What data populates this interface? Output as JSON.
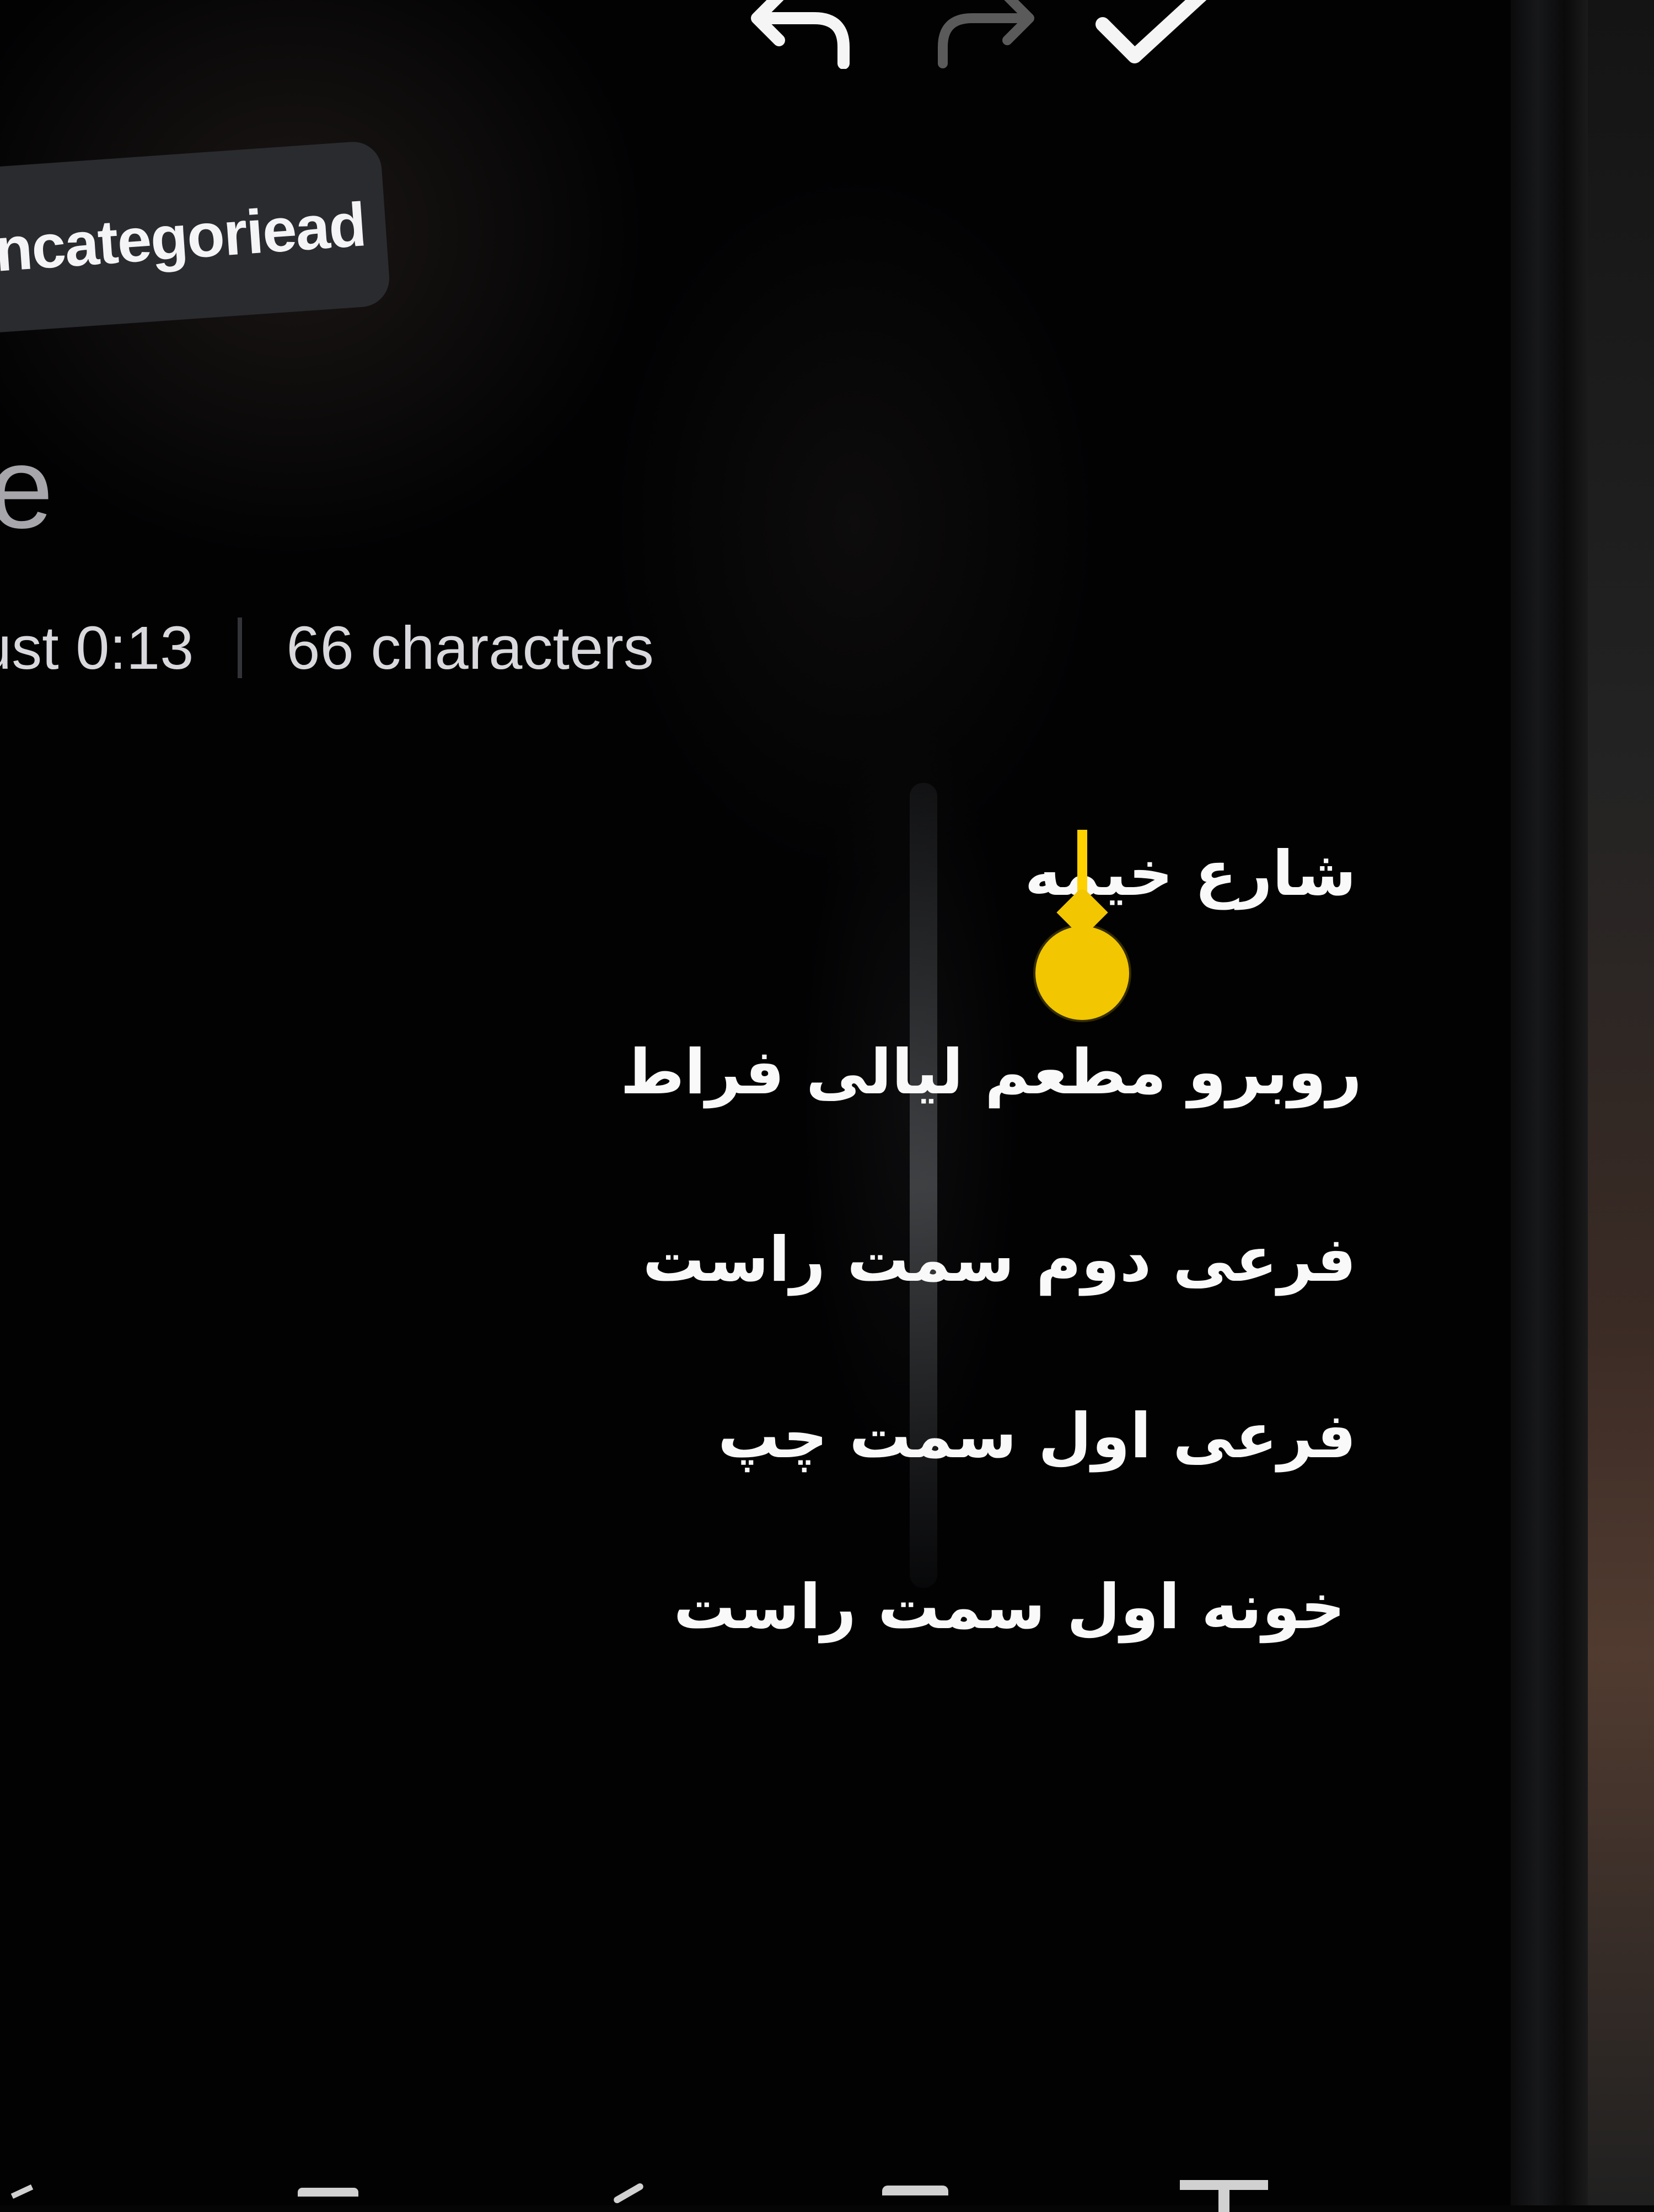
{
  "toolbar": {
    "undo_icon": "undo-icon",
    "redo_icon": "redo-icon",
    "done_icon": "check-icon"
  },
  "header": {
    "category_label": "ncategoriead",
    "placeholder_fragment": "e"
  },
  "meta": {
    "date_time": "ust 0:13",
    "character_count": "66 characters"
  },
  "note": {
    "lines": [
      "شارع خیمه",
      "روبرو مطعم لیالی فراط",
      "فرعی دوم سمت راست",
      "فرعی اول سمت چپ",
      "خونه اول سمت راست"
    ]
  },
  "colors": {
    "screen_background": "#020203",
    "text": "#f9f9f9",
    "cursor": "#ffd100",
    "pill_background": "#2a2b2f"
  },
  "icons": {
    "cursor_handle": "text-cursor-handle-icon",
    "bottom_toolbar": [
      "checklist-icon",
      "image-icon",
      "brush-icon",
      "voice-icon",
      "text-style-icon"
    ]
  }
}
